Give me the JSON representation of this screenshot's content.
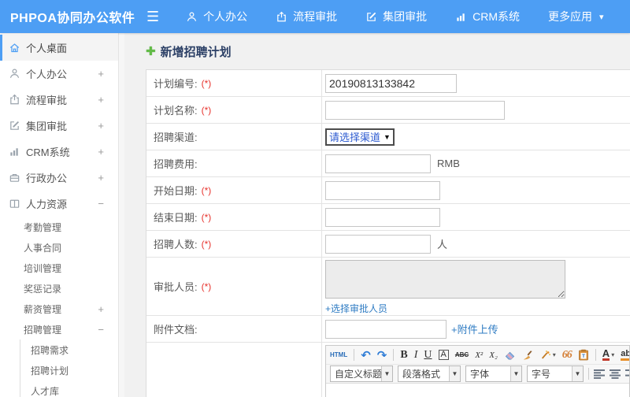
{
  "topbar": {
    "brand": "PHPOA协同办公软件",
    "nav": [
      {
        "label": "个人办公"
      },
      {
        "label": "流程审批"
      },
      {
        "label": "集团审批"
      },
      {
        "label": "CRM系统"
      },
      {
        "label": "更多应用"
      }
    ]
  },
  "sidebar": {
    "items": [
      {
        "label": "个人桌面",
        "expand": ""
      },
      {
        "label": "个人办公",
        "expand": "+"
      },
      {
        "label": "流程审批",
        "expand": "+"
      },
      {
        "label": "集团审批",
        "expand": "+"
      },
      {
        "label": "CRM系统",
        "expand": "+"
      },
      {
        "label": "行政办公",
        "expand": "+"
      },
      {
        "label": "人力资源",
        "expand": "−"
      }
    ],
    "hr_submenu": [
      {
        "label": "考勤管理",
        "expand": ""
      },
      {
        "label": "人事合同",
        "expand": ""
      },
      {
        "label": "培训管理",
        "expand": ""
      },
      {
        "label": "奖惩记录",
        "expand": ""
      },
      {
        "label": "薪资管理",
        "expand": "+"
      },
      {
        "label": "招聘管理",
        "expand": "−"
      }
    ],
    "recruit_submenu": [
      {
        "label": "招聘需求"
      },
      {
        "label": "招聘计划"
      },
      {
        "label": "人才库"
      }
    ]
  },
  "main": {
    "page_title": "新增招聘计划"
  },
  "form": {
    "rows": {
      "plan_no": {
        "label": "计划编号:",
        "required": "(*)",
        "value": "20190813133842"
      },
      "plan_name": {
        "label": "计划名称:",
        "required": "(*)",
        "value": ""
      },
      "channel": {
        "label": "招聘渠道:",
        "required": "",
        "select_value": "请选择渠道"
      },
      "fee": {
        "label": "招聘费用:",
        "required": "",
        "value": "",
        "suffix": "RMB"
      },
      "start_date": {
        "label": "开始日期:",
        "required": "(*)",
        "value": ""
      },
      "end_date": {
        "label": "结束日期:",
        "required": "(*)",
        "value": ""
      },
      "headcount": {
        "label": "招聘人数:",
        "required": "(*)",
        "value": "",
        "suffix": "人"
      },
      "approvers": {
        "label": "审批人员:",
        "required": "(*)",
        "link": "+选择审批人员"
      },
      "attachment": {
        "label": "附件文档:",
        "required": "",
        "value": "",
        "link": "+附件上传"
      }
    }
  },
  "editor": {
    "toolbar1": {
      "html": "HTML",
      "undo": "↶",
      "redo": "↷",
      "bold": "B",
      "italic": "I",
      "underline": "U",
      "font_border": "A",
      "strike": "ABC",
      "sup": "X²",
      "sub": "X₂",
      "quote": "66",
      "font_color": "A",
      "back_color": "ab"
    },
    "toolbar2": {
      "combos": [
        "自定义标题",
        "段落格式",
        "字体",
        "字号"
      ]
    }
  },
  "glyphs": {
    "hamburger": "☰",
    "caret_down": "▾",
    "select_caret": "▼",
    "plus_icon": "✚"
  }
}
